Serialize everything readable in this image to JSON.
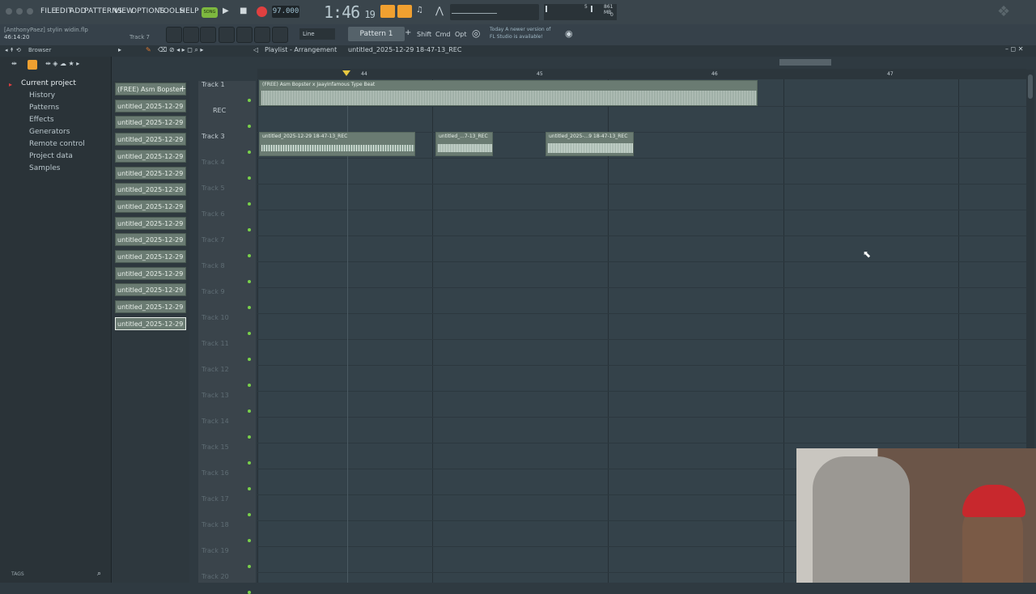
{
  "menu": [
    "FILE",
    "EDIT",
    "ADD",
    "PATTERNS",
    "VIEW",
    "OPTIONS",
    "TOOLS",
    "HELP"
  ],
  "transport": {
    "song_label": "SONG",
    "tempo": "97.000",
    "time": "1:46",
    "time_small": "19",
    "cpu_label": "5",
    "mem_label": "861 MB",
    "voices": "0"
  },
  "project": {
    "user": "[AnthonyPaez] stylin widin.flp",
    "position": "46:14:20",
    "track_hint": "Track 7"
  },
  "toolbar2": {
    "snap": "Line",
    "pattern": "Pattern 1",
    "shift": "Shift",
    "cmd": "Cmd",
    "opt": "Opt",
    "news_line1": "Today  A newer version of",
    "news_line2": "FL Studio is available!"
  },
  "browser": {
    "title": "Browser",
    "items": [
      "Current project",
      "History",
      "Patterns",
      "Effects",
      "Generators",
      "Remote control",
      "Project data",
      "Samples"
    ],
    "tags": "TAGS"
  },
  "playlist": {
    "breadcrumb": "Playlist - Arrangement",
    "subtitle": "untitled_2025-12-29 18-47-13_REC",
    "ruler": [
      "44",
      "45",
      "46",
      "47"
    ]
  },
  "picker": [
    "(FREE) Asm Bopster",
    "untitled_2025-12-29 18-...",
    "untitled_2025-12-29 18-...",
    "untitled_2025-12-29 18-...",
    "untitled_2025-12-29 18-...",
    "untitled_2025-12-29 18-...",
    "untitled_2025-12-29 18-...",
    "untitled_2025-12-29 18-...",
    "untitled_2025-12-29 18-...",
    "untitled_2025-12-29 18-...",
    "untitled_2025-12-29 18-...",
    "untitled_2025-12-29 18-...",
    "untitled_2025-12-29 18-...",
    "untitled_2025-12-29 18-...",
    "untitled_2025-12-29 18-..."
  ],
  "tracks": [
    "Track 1",
    "REC",
    "Track 3",
    "Track 4",
    "Track 5",
    "Track 6",
    "Track 7",
    "Track 8",
    "Track 9",
    "Track 10",
    "Track 11",
    "Track 12",
    "Track 13",
    "Track 14",
    "Track 15",
    "Track 16",
    "Track 17",
    "Track 18",
    "Track 19",
    "Track 20"
  ],
  "clips": {
    "beat": "(FREE) Asm Bopster x JaayInfamous Type Beat",
    "c1": "untitled_2025-12-29 18-47-13_REC",
    "c2": "untitled_...7-13_REC",
    "c3": "untitled_2025-...9 18-47-13_REC"
  },
  "colors": {
    "accent": "#f0a030",
    "clip": "#6a7b72",
    "record": "#e04040",
    "led": "#79d04a"
  }
}
